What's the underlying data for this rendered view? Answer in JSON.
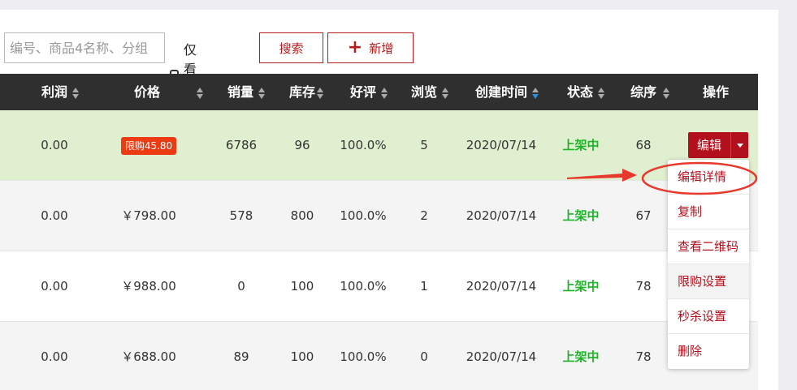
{
  "search": {
    "placeholder": "编号、商品4名称、分组"
  },
  "filter": {
    "only_group_buy_label": "仅看拼单"
  },
  "buttons": {
    "search_label": "搜索",
    "add_label": "新增"
  },
  "table": {
    "headers": {
      "profit": "利润",
      "price": "价格",
      "sales": "销量",
      "stock": "库存",
      "rating": "好评",
      "views": "浏览",
      "created": "创建时间",
      "status": "状态",
      "rank": "综序",
      "actions": "操作"
    },
    "rows": [
      {
        "profit": "0.00",
        "price": "",
        "price_badge": "限购45.80",
        "sales": "6786",
        "stock": "96",
        "rating": "100.0%",
        "views": "5",
        "created": "2020/07/14",
        "status": "上架中",
        "rank": "68"
      },
      {
        "profit": "0.00",
        "price": "￥798.00",
        "sales": "578",
        "stock": "800",
        "rating": "100.0%",
        "views": "2",
        "created": "2020/07/14",
        "status": "上架中",
        "rank": "67"
      },
      {
        "profit": "0.00",
        "price": "￥988.00",
        "sales": "0",
        "stock": "100",
        "rating": "100.0%",
        "views": "1",
        "created": "2020/07/14",
        "status": "上架中",
        "rank": "78"
      },
      {
        "profit": "0.00",
        "price": "￥688.00",
        "sales": "89",
        "stock": "100",
        "rating": "100.0%",
        "views": "0",
        "created": "2020/07/14",
        "status": "上架中",
        "rank": "78"
      }
    ]
  },
  "edit_button": {
    "label": "编辑"
  },
  "dropdown": {
    "items": [
      "编辑详情",
      "复制",
      "查看二维码",
      "限购设置",
      "秒杀设置",
      "删除"
    ]
  },
  "colors": {
    "accent": "#b3101e",
    "status_green": "#1fb32a",
    "header_bg": "#2f2f2f",
    "selected_row": "#e0efcf",
    "badge": "#ec3b12"
  }
}
